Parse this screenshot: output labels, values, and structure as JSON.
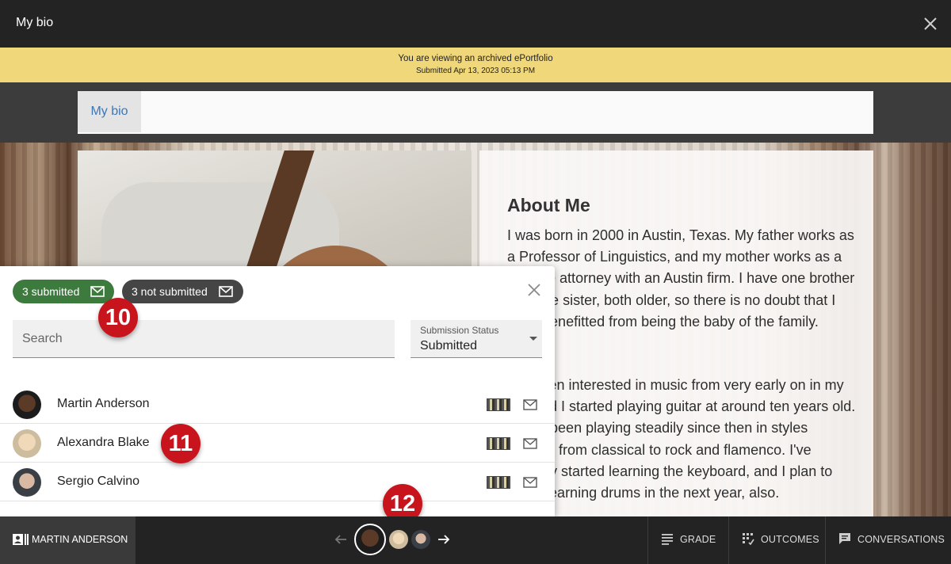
{
  "header": {
    "title": "My bio"
  },
  "banner": {
    "line1": "You are viewing an archived ePortfolio",
    "line2": "Submitted Apr 13, 2023 05:13 PM"
  },
  "page_nav": {
    "tab": "My bio"
  },
  "article": {
    "heading": "About Me",
    "p1": "I was born in 2000 in Austin, Texas. My father works as a Professor of Linguistics, and my mother works as a probate attorney with an Austin firm. I have one brother and one sister, both older, so there is no doubt that I have benefitted from being the baby of the family.",
    "p2": "I've been interested in music from very early on in my life, and I started playing guitar at around ten years old. I have been playing steadily since then in styles ranging from classical to rock and flamenco. I've recently started learning the keyboard, and I plan to begin learning drums in the next year, also."
  },
  "panel": {
    "submitted_label": "3 submitted",
    "not_submitted_label": "3 not submitted",
    "search_placeholder": "Search",
    "status_label": "Submission Status",
    "status_value": "Submitted",
    "students": [
      {
        "name": "Martin Anderson"
      },
      {
        "name": "Alexandra Blake"
      },
      {
        "name": "Sergio Calvino"
      }
    ]
  },
  "callouts": [
    "10",
    "11",
    "12"
  ],
  "bottom_bar": {
    "student": "MARTIN ANDERSON",
    "grade": "GRADE",
    "outcomes": "OUTCOMES",
    "conversations": "CONVERSATIONS"
  },
  "icons": {
    "close": "close-icon",
    "mail": "mail-icon",
    "student_card": "student-card-icon",
    "prev": "arrow-left-icon",
    "next": "arrow-right-icon",
    "grade": "grade-list-icon",
    "outcomes": "outcomes-icon",
    "conversations": "chat-icon"
  },
  "colors": {
    "banner": "#f0d77a",
    "submitted_pill": "#3d7a3d",
    "not_submitted_pill": "#454545",
    "callout": "#c8151d",
    "link": "#3b77b8"
  }
}
